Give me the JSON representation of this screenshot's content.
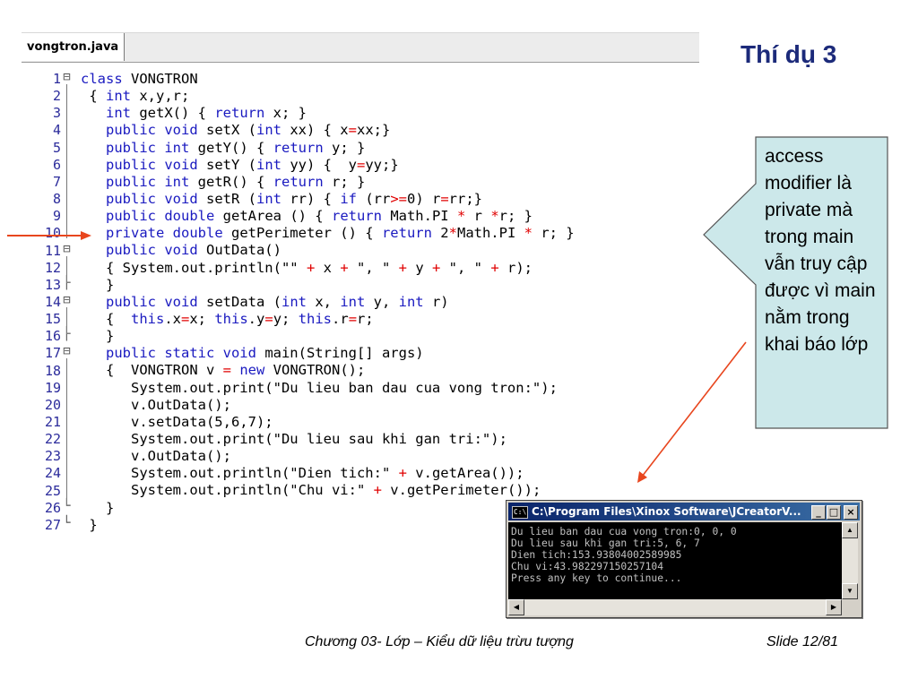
{
  "editor": {
    "tab_label": "vongtron.java",
    "lines": [
      {
        "n": "1",
        "fold": "⊟",
        "code": [
          {
            "t": "class",
            "c": "kw"
          },
          {
            "t": " VONGTRON",
            "c": ""
          }
        ]
      },
      {
        "n": "2",
        "fold": "",
        "code": [
          {
            "t": " { ",
            "c": ""
          },
          {
            "t": "int",
            "c": "kw"
          },
          {
            "t": " x,y,r;",
            "c": ""
          }
        ]
      },
      {
        "n": "3",
        "fold": "",
        "code": [
          {
            "t": "   ",
            "c": ""
          },
          {
            "t": "int",
            "c": "kw"
          },
          {
            "t": " getX() { ",
            "c": ""
          },
          {
            "t": "return",
            "c": "kw"
          },
          {
            "t": " x; }",
            "c": ""
          }
        ]
      },
      {
        "n": "4",
        "fold": "",
        "code": [
          {
            "t": "   ",
            "c": ""
          },
          {
            "t": "public void",
            "c": "kw"
          },
          {
            "t": " setX (",
            "c": ""
          },
          {
            "t": "int",
            "c": "kw"
          },
          {
            "t": " xx) { x",
            "c": ""
          },
          {
            "t": "=",
            "c": "op"
          },
          {
            "t": "xx;}",
            "c": ""
          }
        ]
      },
      {
        "n": "5",
        "fold": "",
        "code": [
          {
            "t": "   ",
            "c": ""
          },
          {
            "t": "public int",
            "c": "kw"
          },
          {
            "t": " getY() { ",
            "c": ""
          },
          {
            "t": "return",
            "c": "kw"
          },
          {
            "t": " y; }",
            "c": ""
          }
        ]
      },
      {
        "n": "6",
        "fold": "",
        "code": [
          {
            "t": "   ",
            "c": ""
          },
          {
            "t": "public void",
            "c": "kw"
          },
          {
            "t": " setY (",
            "c": ""
          },
          {
            "t": "int",
            "c": "kw"
          },
          {
            "t": " yy) {  y",
            "c": ""
          },
          {
            "t": "=",
            "c": "op"
          },
          {
            "t": "yy;}",
            "c": ""
          }
        ]
      },
      {
        "n": "7",
        "fold": "",
        "code": [
          {
            "t": "   ",
            "c": ""
          },
          {
            "t": "public int",
            "c": "kw"
          },
          {
            "t": " getR() { ",
            "c": ""
          },
          {
            "t": "return",
            "c": "kw"
          },
          {
            "t": " r; }",
            "c": ""
          }
        ]
      },
      {
        "n": "8",
        "fold": "",
        "code": [
          {
            "t": "   ",
            "c": ""
          },
          {
            "t": "public void",
            "c": "kw"
          },
          {
            "t": " setR (",
            "c": ""
          },
          {
            "t": "int",
            "c": "kw"
          },
          {
            "t": " rr) { ",
            "c": ""
          },
          {
            "t": "if",
            "c": "kw"
          },
          {
            "t": " (rr",
            "c": ""
          },
          {
            "t": ">=",
            "c": "op"
          },
          {
            "t": "0) r",
            "c": ""
          },
          {
            "t": "=",
            "c": "op"
          },
          {
            "t": "rr;}",
            "c": ""
          }
        ]
      },
      {
        "n": "9",
        "fold": "",
        "code": [
          {
            "t": "   ",
            "c": ""
          },
          {
            "t": "public double",
            "c": "kw"
          },
          {
            "t": " getArea () { ",
            "c": ""
          },
          {
            "t": "return",
            "c": "kw"
          },
          {
            "t": " Math.PI ",
            "c": ""
          },
          {
            "t": "*",
            "c": "op"
          },
          {
            "t": " r ",
            "c": ""
          },
          {
            "t": "*",
            "c": "op"
          },
          {
            "t": "r; }",
            "c": ""
          }
        ]
      },
      {
        "n": "10",
        "fold": "",
        "code": [
          {
            "t": "   ",
            "c": ""
          },
          {
            "t": "private double",
            "c": "kw"
          },
          {
            "t": " getPerimeter () { ",
            "c": ""
          },
          {
            "t": "return",
            "c": "kw"
          },
          {
            "t": " 2",
            "c": ""
          },
          {
            "t": "*",
            "c": "op"
          },
          {
            "t": "Math.PI ",
            "c": ""
          },
          {
            "t": "*",
            "c": "op"
          },
          {
            "t": " r; }",
            "c": ""
          }
        ]
      },
      {
        "n": "11",
        "fold": "⊟",
        "code": [
          {
            "t": "   ",
            "c": ""
          },
          {
            "t": "public void",
            "c": "kw"
          },
          {
            "t": " OutData()",
            "c": ""
          }
        ]
      },
      {
        "n": "12",
        "fold": "",
        "code": [
          {
            "t": "   { System.out.println(\"\" ",
            "c": ""
          },
          {
            "t": "+",
            "c": "op"
          },
          {
            "t": " x ",
            "c": ""
          },
          {
            "t": "+",
            "c": "op"
          },
          {
            "t": " \", \" ",
            "c": ""
          },
          {
            "t": "+",
            "c": "op"
          },
          {
            "t": " y ",
            "c": ""
          },
          {
            "t": "+",
            "c": "op"
          },
          {
            "t": " \", \" ",
            "c": ""
          },
          {
            "t": "+",
            "c": "op"
          },
          {
            "t": " r);",
            "c": ""
          }
        ]
      },
      {
        "n": "13",
        "fold": "├",
        "code": [
          {
            "t": "   }",
            "c": ""
          }
        ]
      },
      {
        "n": "14",
        "fold": "⊟",
        "code": [
          {
            "t": "   ",
            "c": ""
          },
          {
            "t": "public void",
            "c": "kw"
          },
          {
            "t": " setData (",
            "c": ""
          },
          {
            "t": "int",
            "c": "kw"
          },
          {
            "t": " x, ",
            "c": ""
          },
          {
            "t": "int",
            "c": "kw"
          },
          {
            "t": " y, ",
            "c": ""
          },
          {
            "t": "int",
            "c": "kw"
          },
          {
            "t": " r)",
            "c": ""
          }
        ]
      },
      {
        "n": "15",
        "fold": "",
        "code": [
          {
            "t": "   {  ",
            "c": ""
          },
          {
            "t": "this",
            "c": "kw"
          },
          {
            "t": ".x",
            "c": ""
          },
          {
            "t": "=",
            "c": "op"
          },
          {
            "t": "x; ",
            "c": ""
          },
          {
            "t": "this",
            "c": "kw"
          },
          {
            "t": ".y",
            "c": ""
          },
          {
            "t": "=",
            "c": "op"
          },
          {
            "t": "y; ",
            "c": ""
          },
          {
            "t": "this",
            "c": "kw"
          },
          {
            "t": ".r",
            "c": ""
          },
          {
            "t": "=",
            "c": "op"
          },
          {
            "t": "r;",
            "c": ""
          }
        ]
      },
      {
        "n": "16",
        "fold": "├",
        "code": [
          {
            "t": "   }",
            "c": ""
          }
        ]
      },
      {
        "n": "17",
        "fold": "⊟",
        "code": [
          {
            "t": "   ",
            "c": ""
          },
          {
            "t": "public static void",
            "c": "kw"
          },
          {
            "t": " main(String[] args)",
            "c": ""
          }
        ]
      },
      {
        "n": "18",
        "fold": "",
        "code": [
          {
            "t": "   {  VONGTRON v ",
            "c": ""
          },
          {
            "t": "=",
            "c": "op"
          },
          {
            "t": " ",
            "c": ""
          },
          {
            "t": "new",
            "c": "kw"
          },
          {
            "t": " VONGTRON();",
            "c": ""
          }
        ]
      },
      {
        "n": "19",
        "fold": "",
        "code": [
          {
            "t": "      System.out.print(\"Du lieu ban dau cua vong tron:\");",
            "c": ""
          }
        ]
      },
      {
        "n": "20",
        "fold": "",
        "code": [
          {
            "t": "      v.OutData();",
            "c": ""
          }
        ]
      },
      {
        "n": "21",
        "fold": "",
        "code": [
          {
            "t": "      v.setData(5,6,7);",
            "c": ""
          }
        ]
      },
      {
        "n": "22",
        "fold": "",
        "code": [
          {
            "t": "      System.out.print(\"Du lieu sau khi gan tri:\");",
            "c": ""
          }
        ]
      },
      {
        "n": "23",
        "fold": "",
        "code": [
          {
            "t": "      v.OutData();",
            "c": ""
          }
        ]
      },
      {
        "n": "24",
        "fold": "",
        "code": [
          {
            "t": "      System.out.println(\"Dien tich:\" ",
            "c": ""
          },
          {
            "t": "+",
            "c": "op"
          },
          {
            "t": " v.getArea());",
            "c": ""
          }
        ]
      },
      {
        "n": "25",
        "fold": "",
        "code": [
          {
            "t": "      System.out.println(\"Chu vi:\" ",
            "c": ""
          },
          {
            "t": "+",
            "c": "op"
          },
          {
            "t": " v.getPerimeter());",
            "c": ""
          }
        ]
      },
      {
        "n": "26",
        "fold": "└",
        "code": [
          {
            "t": "   }",
            "c": ""
          }
        ]
      },
      {
        "n": "27",
        "fold": "└",
        "code": [
          {
            "t": " }",
            "c": ""
          }
        ]
      }
    ]
  },
  "slide": {
    "title": "Thí dụ 3",
    "callout_text": "access modifier là private mà trong main vẫn truy cập được vì main nằm trong khai báo lớp",
    "footer_left": "Chương 03- Lớp – Kiểu dữ liệu trừu tượng",
    "footer_right": "Slide 12/81",
    "colors": {
      "title": "#1c2a7a",
      "callout_fill": "#cce8ea",
      "arrow": "#e8461e"
    }
  },
  "console": {
    "caption": "C:\\Program Files\\Xinox Software\\JCreatorV...",
    "output": [
      "Du lieu ban dau cua vong tron:0, 0, 0",
      "Du lieu sau khi gan tri:5, 6, 7",
      "Dien tich:153.93804002589985",
      "Chu vi:43.982297150257104",
      "Press any key to continue..."
    ],
    "buttons": {
      "minimize": "_",
      "maximize": "□",
      "close": "×"
    }
  }
}
